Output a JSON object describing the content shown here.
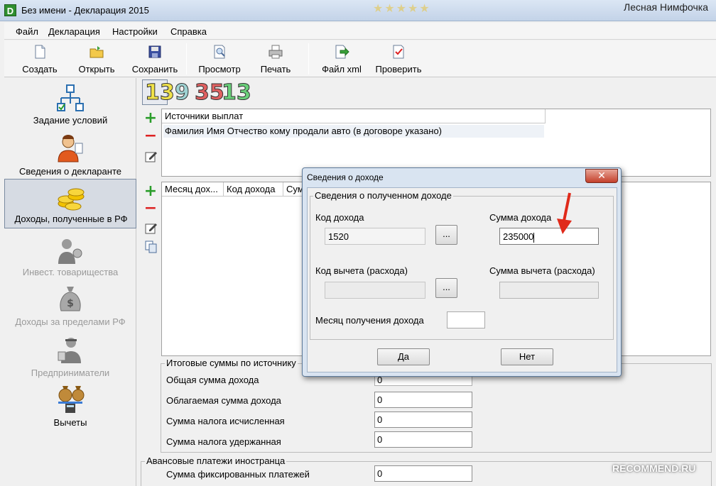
{
  "window": {
    "app_icon_letter": "D",
    "title": "Без имени - Декларация 2015",
    "user_name": "Лесная Нимфочка"
  },
  "menu": [
    "Файл",
    "Декларация",
    "Настройки",
    "Справка"
  ],
  "toolbar": {
    "create": "Создать",
    "open": "Открыть",
    "save": "Сохранить",
    "preview": "Просмотр",
    "print": "Печать",
    "file_xml": "Файл xml",
    "check": "Проверить"
  },
  "nav": [
    {
      "label": "Задание условий",
      "icon": "conditions-tree-icon",
      "state": "normal"
    },
    {
      "label": "Сведения о декларанте",
      "icon": "person-icon",
      "state": "normal"
    },
    {
      "label": "Доходы, полученные в РФ",
      "icon": "coins-icon",
      "state": "active"
    },
    {
      "label": "Инвест. товарищества",
      "icon": "investor-icon",
      "state": "disabled"
    },
    {
      "label": "Доходы за пределами РФ",
      "icon": "money-bag-icon",
      "state": "disabled"
    },
    {
      "label": "Предприниматели",
      "icon": "entrepreneur-icon",
      "state": "disabled"
    },
    {
      "label": "Вычеты",
      "icon": "deductions-icon",
      "state": "normal"
    }
  ],
  "rates": [
    {
      "value": "13",
      "color": "#f0e24a"
    },
    {
      "value": "9",
      "color": "#9fd3d3"
    },
    {
      "value": "35",
      "color": "#e06060"
    },
    {
      "value": "13",
      "color": "#6ad07a"
    }
  ],
  "sources": {
    "header": "Источники выплат",
    "rows": [
      "Фамилия Имя Отчество кому продали авто (в договоре указано)"
    ]
  },
  "income_table": {
    "headers": [
      "Месяц дох...",
      "Код дохода",
      "Сум"
    ]
  },
  "totals": {
    "group_title": "Итоговые суммы по источнику",
    "rows": [
      {
        "label": "Общая сумма дохода",
        "value": "0"
      },
      {
        "label": "Облагаемая сумма дохода",
        "value": "0"
      },
      {
        "label": "Сумма налога исчисленная",
        "value": "0"
      },
      {
        "label": "Сумма налога удержанная",
        "value": "0"
      }
    ]
  },
  "advances": {
    "group_title": "Авансовые платежи иностранца",
    "rows": [
      {
        "label": "Сумма фиксированных платежей",
        "value": "0"
      }
    ]
  },
  "dialog": {
    "title": "Сведения о доходе",
    "group_title": "Сведения о полученном доходе",
    "income_code_label": "Код дохода",
    "income_code_value": "1520",
    "income_sum_label": "Сумма дохода",
    "income_sum_value": "235000",
    "deduction_code_label": "Код вычета (расхода)",
    "deduction_code_value": "",
    "deduction_sum_label": "Сумма вычета (расхода)",
    "deduction_sum_value": "",
    "month_label": "Месяц получения дохода",
    "month_value": "",
    "browse": "...",
    "yes": "Да",
    "no": "Нет"
  },
  "colors": {
    "annotation_arrow": "#e02a1a",
    "title_bar": "#c3d3e8",
    "active_nav": "#d6dbe3"
  },
  "watermark": "RECOMMEND.RU"
}
